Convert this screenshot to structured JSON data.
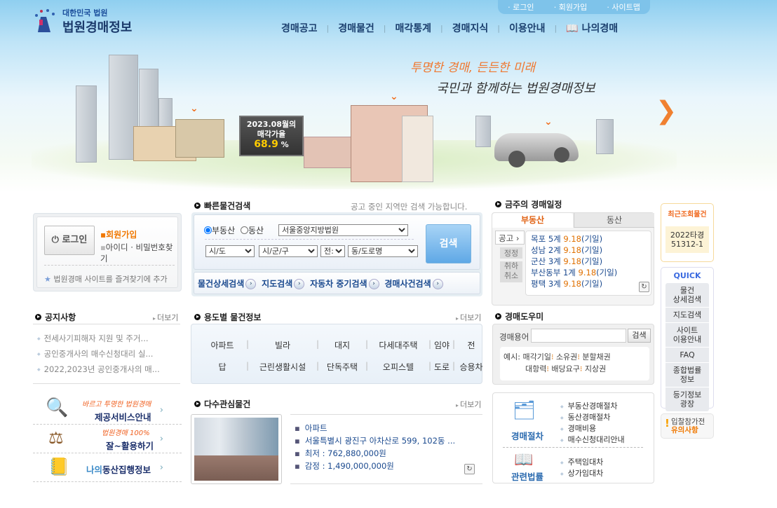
{
  "header": {
    "logo_small": "대한민국 법원",
    "logo_big": "법원경매정보",
    "top_links": [
      "로그인",
      "회원가입",
      "사이트맵"
    ],
    "nav": [
      "경매공고",
      "경매물건",
      "매각통계",
      "경매지식",
      "이용안내",
      "나의경매"
    ]
  },
  "banner": {
    "slogan1": "투명한 경매, 든든한 미래",
    "slogan2": "국민과 함께하는 법원경매정보",
    "billboard_line1": "2023.08월의",
    "billboard_line2": "매각가율",
    "billboard_rate": "68.9",
    "billboard_unit": "%"
  },
  "login": {
    "button": "로그인",
    "join": "회원가입",
    "find": "아이디 · 비밀번호찾기",
    "favorite": "법원경매 사이트를 즐겨찾기에 추가"
  },
  "notice": {
    "title": "공지사항",
    "more": "더보기",
    "items": [
      "전세사기피해자 지원 및 주거...",
      "공인중개사의 매수신청대리 실...",
      "2022,2023년 공인중개사의 매..."
    ]
  },
  "promos": [
    {
      "hand": "바르고 투명한 법원경매",
      "label": "제공서비스안내"
    },
    {
      "hand": "법원경매 100%",
      "label": "잘~활용하기"
    },
    {
      "label_a": "나의",
      "label_b": "동산집행정보"
    }
  ],
  "quick_search": {
    "title": "빠른물건검색",
    "hint": "공고 중인 지역만 검색 가능합니다.",
    "radio_realestate": "부동산",
    "radio_movable": "동산",
    "court": "서울중앙지방법원",
    "sido": "시/도",
    "sigungu": "시/군/구",
    "jeon": "전:",
    "dong": "동/도로명",
    "search": "검색",
    "links": [
      "물건상세검색",
      "지도검색",
      "자동차 중기검색",
      "경매사건검색"
    ]
  },
  "usage": {
    "title": "용도별 물건정보",
    "more": "더보기",
    "row1": [
      "아파트",
      "빌라",
      "대지",
      "다세대주택",
      "임야",
      "전"
    ],
    "row2": [
      "답",
      "근린생활시설",
      "단독주택",
      "오피스텔",
      "도로",
      "승용차"
    ]
  },
  "popular": {
    "title": "다수관심물건",
    "more": "더보기",
    "items": [
      "아파트",
      "서울특별시 광진구 아차산로 599, 102동 ...",
      "최저 : 762,880,000원",
      "감정 : 1,490,000,000원"
    ]
  },
  "schedule": {
    "title": "금주의 경매일정",
    "tabs": [
      "부동산",
      "동산"
    ],
    "side": [
      "공고",
      "정정",
      "취하\n취소"
    ],
    "items": [
      {
        "place": "목포 5계",
        "date": "9.18",
        "type": "(기일)"
      },
      {
        "place": "성남 2계",
        "date": "9.18",
        "type": "(기일)"
      },
      {
        "place": "군산 3계",
        "date": "9.18",
        "type": "(기일)"
      },
      {
        "place": "부산동부 1계",
        "date": "9.18",
        "type": "(기일)"
      },
      {
        "place": "평택 3계",
        "date": "9.18",
        "type": "(기일)"
      }
    ]
  },
  "helper": {
    "title": "경매도우미",
    "term_label": "경매용어",
    "search": "검색",
    "example_label": "예시:",
    "examples": [
      "매각기일",
      "소유권",
      "분할채권",
      "대항력",
      "배당요구",
      "지상권"
    ]
  },
  "procedure": {
    "title": "경매절차",
    "items": [
      "부동산경매절차",
      "동산경매절차",
      "경매비용",
      "매수신청대리안내"
    ],
    "law_title": "관련법률",
    "law_items": [
      "주택임대차",
      "상가임대차"
    ]
  },
  "recent": {
    "title": "최근조회물건",
    "case": "2022타경\n51312-1"
  },
  "quick": {
    "title": "QUICK",
    "items": [
      "물건\n상세검색",
      "지도검색",
      "사이트\n이용안내",
      "FAQ",
      "종합법률\n정보",
      "등기정보\n광장"
    ]
  },
  "caution": {
    "line1": "입찰참가전",
    "line2": "유의사항"
  }
}
